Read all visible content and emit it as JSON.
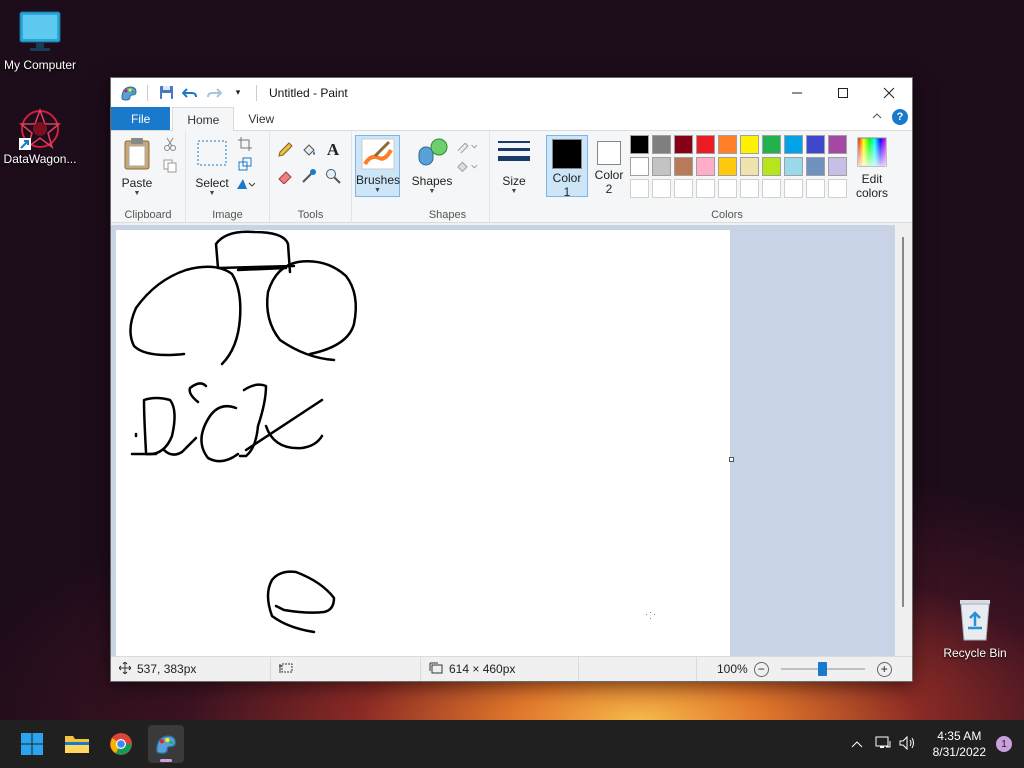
{
  "desktop": {
    "icons": [
      {
        "label": "My Computer"
      },
      {
        "label": "DataWagon..."
      },
      {
        "label": "Recycle Bin"
      }
    ]
  },
  "window": {
    "title": "Untitled - Paint",
    "tabs": {
      "file": "File",
      "home": "Home",
      "view": "View"
    }
  },
  "ribbon": {
    "clipboard": {
      "label": "Clipboard",
      "paste": "Paste"
    },
    "image": {
      "label": "Image",
      "select": "Select"
    },
    "tools": {
      "label": "Tools"
    },
    "brushes": {
      "label": "Brushes"
    },
    "shapes": {
      "label": "Shapes",
      "button": "Shapes"
    },
    "size": {
      "label": "Size"
    },
    "color1": {
      "line1": "Color",
      "line2": "1"
    },
    "color2": {
      "line1": "Color",
      "line2": "2"
    },
    "colors": {
      "label": "Colors",
      "edit_line1": "Edit",
      "edit_line2": "colors"
    },
    "palette_row1": [
      "#000000",
      "#7f7f7f",
      "#880015",
      "#ed1c24",
      "#ff7f27",
      "#fff200",
      "#22b14c",
      "#00a2e8",
      "#3f48cc",
      "#a349a4"
    ],
    "palette_row2": [
      "#ffffff",
      "#c3c3c3",
      "#b97a57",
      "#ffaec9",
      "#ffc90e",
      "#efe4b0",
      "#b5e61d",
      "#99d9ea",
      "#7092be",
      "#c8bfe7"
    ]
  },
  "status": {
    "cursor_pos": "537, 383px",
    "canvas_size": "614 × 460px",
    "zoom": "100%",
    "zoom_fraction": 0.5
  },
  "taskbar": {
    "time": "4:35 AM",
    "date": "8/31/2022",
    "notifications": "1"
  }
}
